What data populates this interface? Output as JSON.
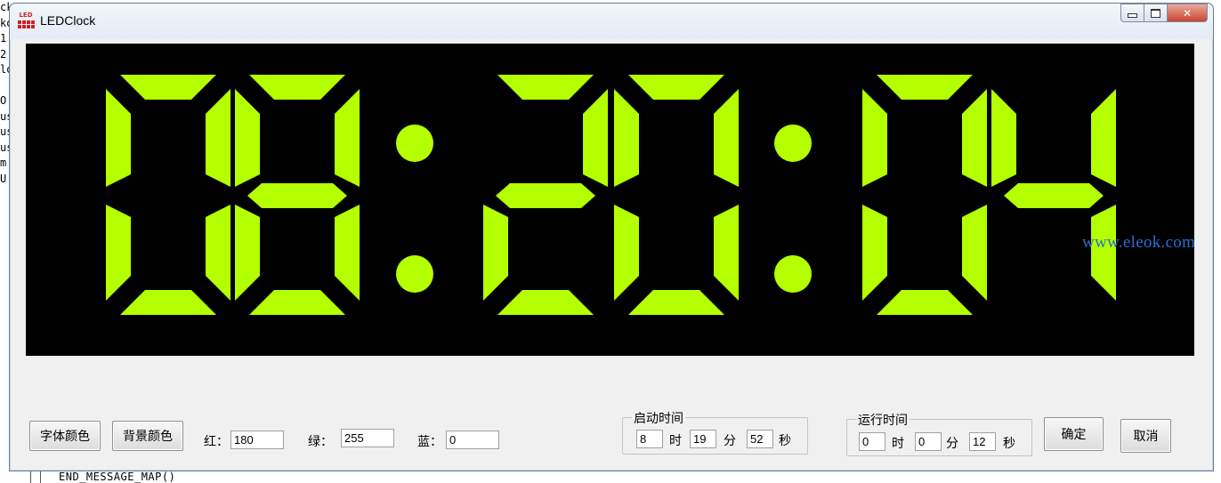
{
  "window": {
    "title": "LEDClock",
    "icon_text": "LED"
  },
  "caption_buttons": {
    "minimize": "minimize",
    "maximize": "maximize",
    "close": "✕"
  },
  "display": {
    "time": "08:20:04",
    "digits": [
      "0",
      "8",
      "2",
      "0",
      "0",
      "4"
    ],
    "segment_color": "#B4FF00",
    "background_color": "#000000"
  },
  "watermark": "www.eleok.com",
  "controls": {
    "font_color_button": "字体颜色",
    "bg_color_button": "背景颜色",
    "red_label": "红：",
    "red_value": "180",
    "green_label": "绿：",
    "green_value": "255",
    "blue_label": "蓝：",
    "blue_value": "0",
    "start_time": {
      "title": "启动时间",
      "hour": "8",
      "hour_label": "时",
      "minute": "19",
      "minute_label": "分",
      "second": "52",
      "second_label": "秒"
    },
    "run_time": {
      "title": "运行时间",
      "hour": "0",
      "hour_label": "时",
      "minute": "0",
      "minute_label": "分",
      "second": "12",
      "second_label": "秒"
    },
    "ok_button": "确定",
    "cancel_button": "取消"
  },
  "background": {
    "left_strip": [
      "ck",
      "ko",
      "1",
      "2",
      "lo",
      "",
      "O",
      "us",
      "us",
      "us",
      "m",
      "U"
    ],
    "bottom_code": "END_MESSAGE_MAP()"
  }
}
